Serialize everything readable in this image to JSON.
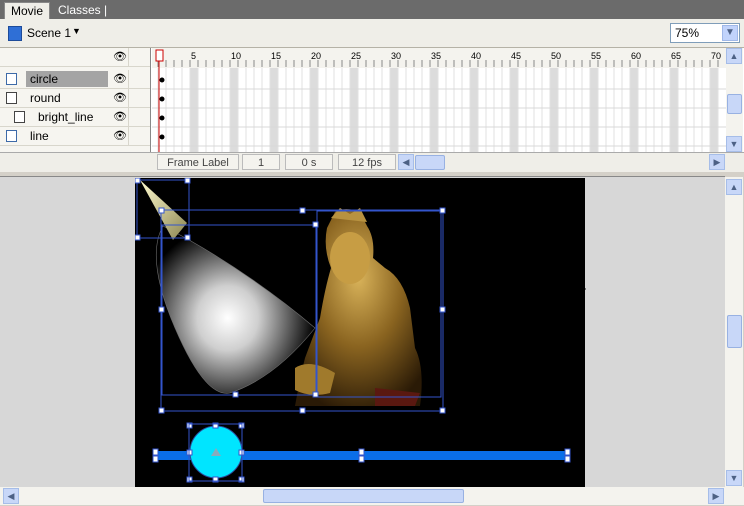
{
  "tabs": [
    {
      "label": "Movie",
      "active": true
    },
    {
      "label": "Classes |",
      "active": false
    }
  ],
  "scene": {
    "label": "Scene 1"
  },
  "zoom": {
    "value": "75%"
  },
  "timeline": {
    "frame_numbers": [
      "5",
      "10",
      "15",
      "20",
      "25",
      "30",
      "35",
      "40",
      "45",
      "50",
      "55",
      "60",
      "65",
      "70"
    ],
    "layers": [
      {
        "name": "circle",
        "selected": true,
        "icon": "layer-icon"
      },
      {
        "name": "round",
        "selected": false,
        "icon": "movieclip-layer-icon"
      },
      {
        "name": "bright_line",
        "selected": false,
        "icon": "movieclip-layer-icon"
      },
      {
        "name": "line",
        "selected": false,
        "icon": "layer-icon"
      }
    ],
    "status": {
      "frame_label": "Frame Label",
      "frame": "1",
      "time": "0 s",
      "fps": "12 fps"
    }
  },
  "colors": {
    "accent": "#00e5ff",
    "bar": "#0a6ee8",
    "selection": "#3355cc"
  }
}
